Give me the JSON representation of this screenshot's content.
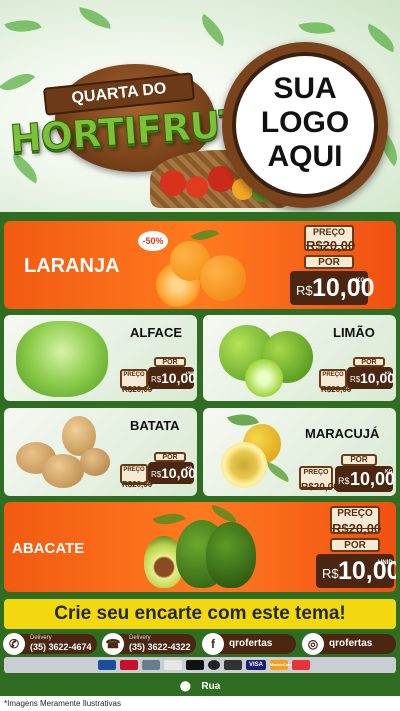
{
  "header": {
    "title_top": "QUARTA DO",
    "title_main": "HORTIFRUTI",
    "logo_text": [
      "SUA",
      "LOGO",
      "AQUI"
    ]
  },
  "products": {
    "laranja": {
      "name": "LARANJA",
      "discount": "-50%",
      "from_label": "PREÇO",
      "old_price": "R$20,00",
      "por_label": "POR",
      "currency": "R$",
      "price": "10,00",
      "unit": "KG"
    },
    "alface": {
      "name": "ALFACE",
      "from_label": "PREÇO",
      "old_price": "R$20,00",
      "por_label": "POR",
      "currency": "R$",
      "price": "10,00",
      "unit": "UNID"
    },
    "limao": {
      "name": "LIMÃO",
      "from_label": "PREÇO",
      "old_price": "R$20,00",
      "por_label": "POR",
      "currency": "R$",
      "price": "10,00",
      "unit": "KG"
    },
    "batata": {
      "name": "BATATA",
      "from_label": "PREÇO",
      "old_price": "R$20,00",
      "por_label": "POR",
      "currency": "R$",
      "price": "10,00",
      "unit": "KG"
    },
    "maracuja": {
      "name": "MARACUJÁ",
      "from_label": "PREÇO",
      "old_price": "R$20,00",
      "por_label": "POR",
      "currency": "R$",
      "price": "10,00",
      "unit": "KG"
    },
    "abacate": {
      "name": "ABACATE",
      "from_label": "PREÇO",
      "old_price": "R$20,00",
      "por_label": "POR",
      "currency": "R$",
      "price": "10,00",
      "unit": "UNID"
    }
  },
  "cta": "Crie seu encarte com este tema!",
  "contacts": {
    "whatsapp": {
      "label": "Delivery",
      "phone": "(35) 3622-4674"
    },
    "phone": {
      "label": "Delivery",
      "phone": "(35) 3622-4322"
    },
    "facebook": {
      "handle": "qrofertas"
    },
    "instagram": {
      "handle": "qrofertas"
    }
  },
  "payments": [
    "VISA",
    "MasterCard"
  ],
  "address": "Rua",
  "disclaimer": "*Imagens Meramente Ilustrativas",
  "colors": {
    "orange": "#f25a12",
    "brown": "#4b2611",
    "green": "#2f6d22",
    "yellow": "#f4d80f"
  }
}
